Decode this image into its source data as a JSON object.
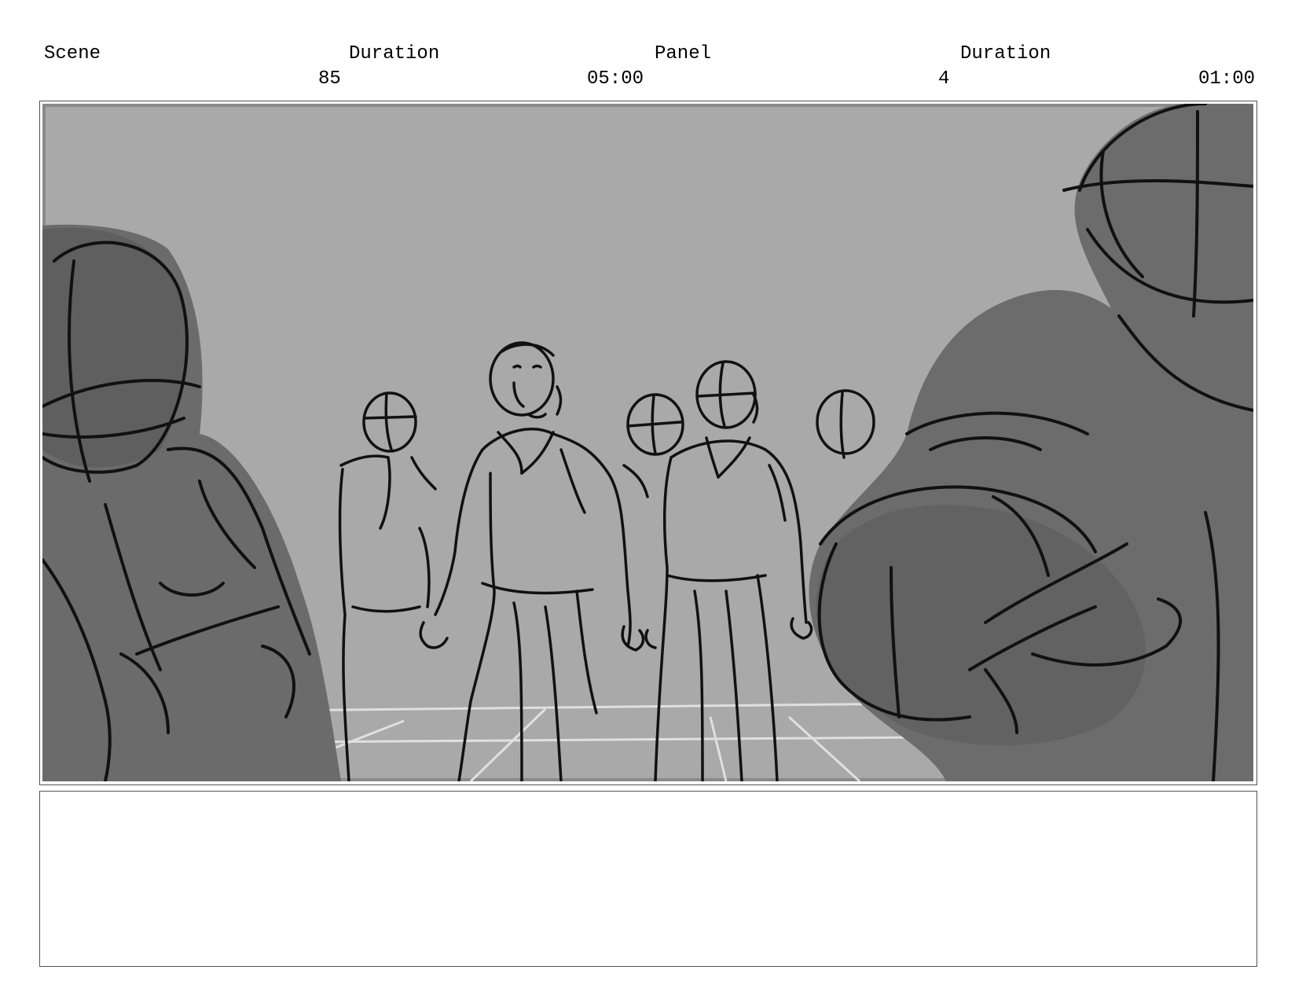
{
  "header": {
    "scene_label": "Scene",
    "duration_label": "Duration",
    "panel_label": "Panel",
    "panel_duration_label": "Duration",
    "scene_value": "85",
    "scene_duration_value": "05:00",
    "panel_value": "4",
    "panel_duration_value": "01:00"
  },
  "panel": {
    "image_kind": "storyboard-sketch"
  },
  "notes": {
    "text": ""
  }
}
